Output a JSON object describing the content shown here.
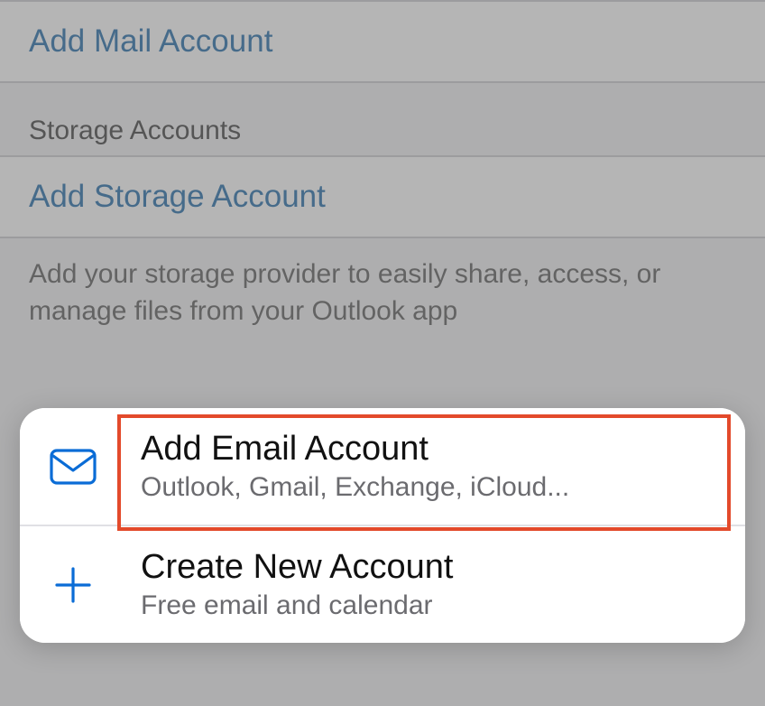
{
  "mail": {
    "add_mail_label": "Add Mail Account"
  },
  "storage": {
    "header": "Storage Accounts",
    "add_storage_label": "Add Storage Account",
    "footer": "Add your storage provider to easily share, access, or manage files from your Outlook app"
  },
  "sheet": {
    "add_email": {
      "title": "Add Email Account",
      "subtitle": "Outlook, Gmail, Exchange, iCloud..."
    },
    "create_new": {
      "title": "Create New Account",
      "subtitle": "Free email and calendar"
    }
  }
}
